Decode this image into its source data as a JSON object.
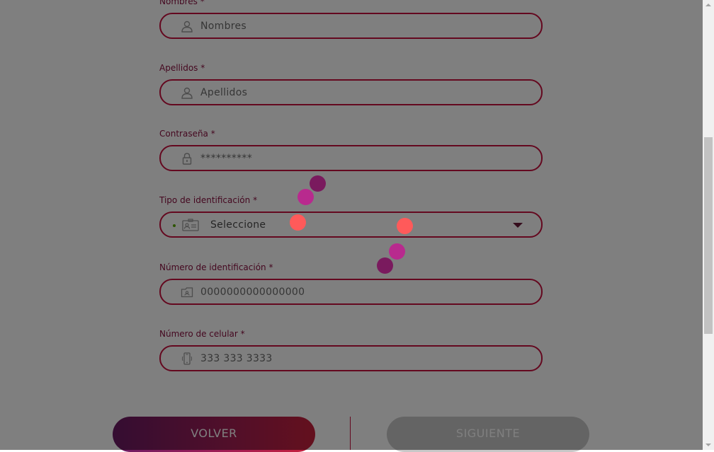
{
  "form": {
    "nombres": {
      "label": "Nombres *",
      "placeholder": "Nombres",
      "icon": "user-icon"
    },
    "apellidos": {
      "label": "Apellidos *",
      "placeholder": "Apellidos",
      "icon": "user-icon"
    },
    "contrasena": {
      "label": "Contraseña *",
      "placeholder": "**********",
      "icon": "lock-icon"
    },
    "tipo_identificacion": {
      "label": "Tipo de identificación *",
      "selected": "Seleccione",
      "icon": "id-card-icon"
    },
    "numero_identificacion": {
      "label": "Número de identificación *",
      "placeholder": "0000000000000000",
      "icon": "id-folder-icon"
    },
    "numero_celular": {
      "label": "Número de celular *",
      "placeholder": "333 333 3333",
      "icon": "phone-icon"
    }
  },
  "buttons": {
    "back_label": "VOLVER",
    "next_label": "SIGUIENTE"
  },
  "colors": {
    "accent": "#c8103e",
    "label": "#8a1040",
    "gradient_start": "#6a1a64",
    "gradient_end": "#c8203c",
    "disabled_button": "#c8c8c8",
    "overlay": "rgba(0,0,0,0.5)",
    "spinner_dots": [
      "#7a1a5e",
      "#b82a8e",
      "#ff5a5a"
    ]
  }
}
